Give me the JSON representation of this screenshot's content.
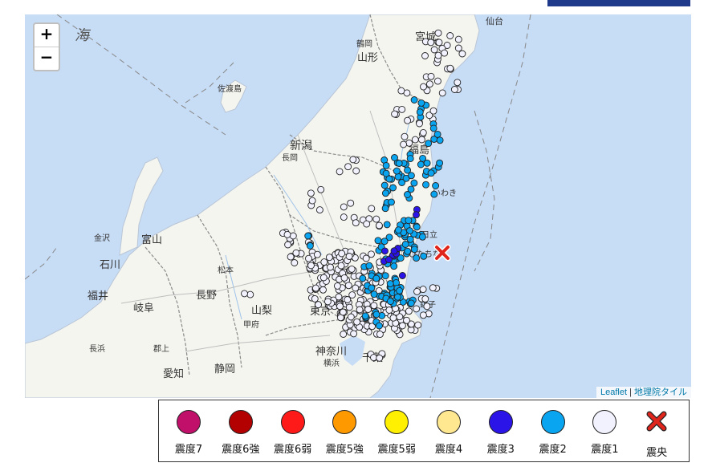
{
  "map": {
    "zoom_in": "+",
    "zoom_out": "−",
    "attribution": {
      "leaflet": "Leaflet",
      "sep": " | ",
      "tiles": "地理院タイル"
    },
    "labels": {
      "umi": "海",
      "miyagi": "宮城",
      "yamagata": "山形",
      "niigata": "新潟",
      "fukushima": "福島",
      "toyama": "富山",
      "ishikawa": "石川",
      "fukui": "福井",
      "gifu": "岐阜",
      "nagano": "長野",
      "yamanashi": "山梨",
      "tokyo": "東京",
      "kanagawa": "神奈川",
      "chiba": "千葉",
      "shizuoka": "静岡",
      "aichi": "愛知",
      "sado": "佐渡島",
      "sendai": "仙台",
      "iwaki": "いわき",
      "hitachi": "日立",
      "hitachinaka": "ひたちな",
      "kanazawa": "金沢",
      "matsumoto": "松本",
      "choshi": "銚子",
      "tsuruoka": "鶴岡",
      "nagaoka": "長岡",
      "yokohama": "横浜",
      "kofu": "甲府",
      "gujo": "郡上",
      "nagahama": "長浜"
    },
    "stations": {
      "shindo1": {
        "color": "#f2f2ff"
      },
      "shindo2": {
        "color": "#0aa5f0"
      },
      "shindo3": {
        "color": "#2b14e8"
      }
    },
    "epicenter_color": "#e0261c"
  },
  "legend": {
    "items": [
      {
        "label": "震度7",
        "color": "#c0106a"
      },
      {
        "label": "震度6強",
        "color": "#b30000"
      },
      {
        "label": "震度6弱",
        "color": "#ff1a1a"
      },
      {
        "label": "震度5強",
        "color": "#ff9900"
      },
      {
        "label": "震度5弱",
        "color": "#ffef00"
      },
      {
        "label": "震度4",
        "color": "#ffe890"
      },
      {
        "label": "震度3",
        "color": "#2b14e8"
      },
      {
        "label": "震度2",
        "color": "#0aa5f0"
      },
      {
        "label": "震度1",
        "color": "#f2f2ff"
      },
      {
        "label": "震央",
        "color": "#e0261c"
      }
    ]
  }
}
